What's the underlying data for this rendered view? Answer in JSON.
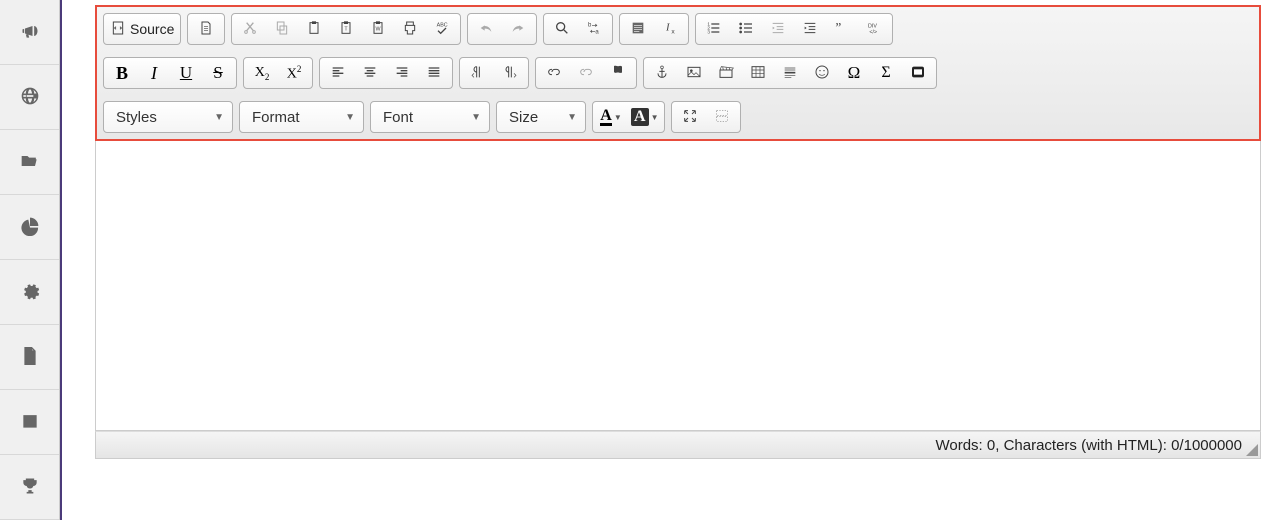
{
  "sidebar": {
    "items": [
      {
        "icon": "bullhorn"
      },
      {
        "icon": "globe"
      },
      {
        "icon": "folder-open"
      },
      {
        "icon": "pie-chart"
      },
      {
        "icon": "gear"
      },
      {
        "icon": "file"
      },
      {
        "icon": "calendar"
      },
      {
        "icon": "trophy"
      }
    ]
  },
  "toolbar": {
    "source_label": "Source",
    "combos": {
      "styles": "Styles",
      "format": "Format",
      "font": "Font",
      "size": "Size"
    }
  },
  "status": {
    "text": "Words: 0, Characters (with HTML): 0/1000000"
  }
}
